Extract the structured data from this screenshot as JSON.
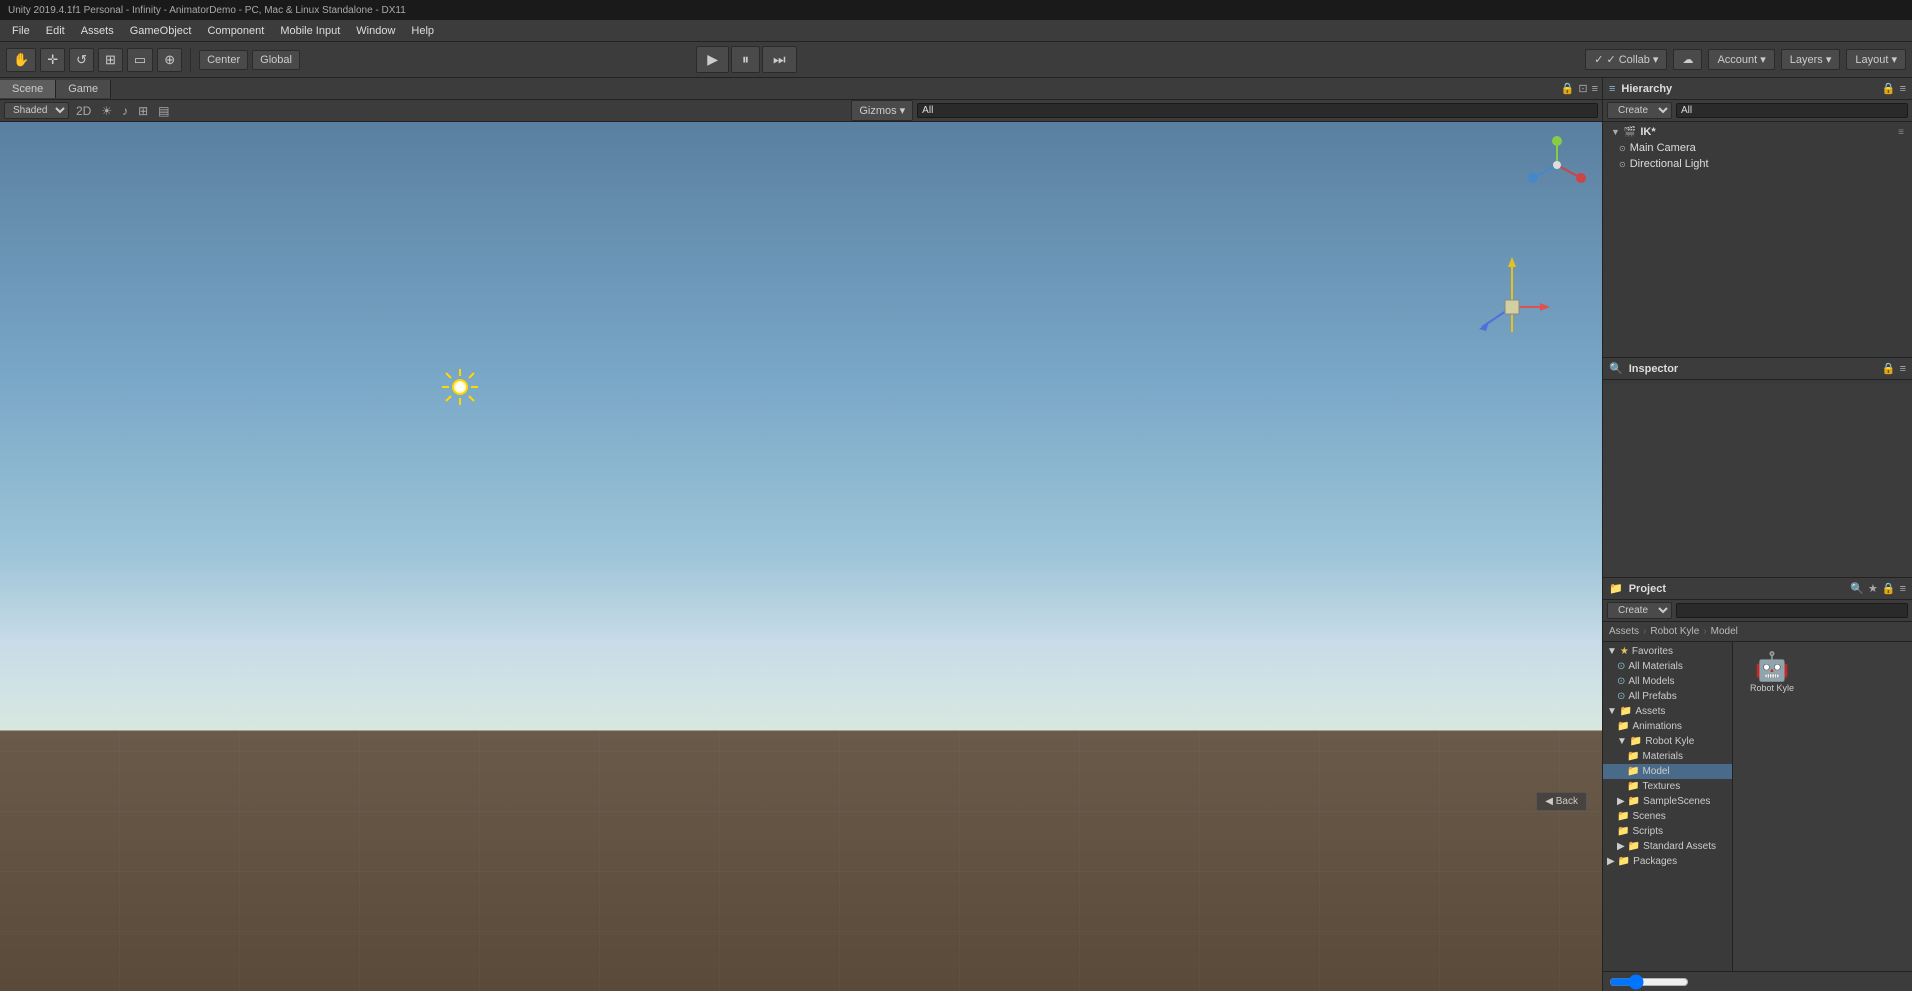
{
  "titlebar": {
    "text": "Unity 2019.4.1f1 Personal - Infinity - AnimatorDemo - PC, Mac & Linux Standalone - DX11"
  },
  "menubar": {
    "items": [
      "File",
      "Edit",
      "Assets",
      "GameObject",
      "Component",
      "Mobile Input",
      "Window",
      "Help"
    ]
  },
  "toolbar": {
    "hand_label": "✋",
    "move_label": "✛",
    "rotate_label": "↺",
    "scale_label": "⊞",
    "rect_label": "⬜",
    "transform_label": "⊕",
    "center_label": "Center",
    "global_label": "Global",
    "play_label": "▶",
    "pause_label": "⏸",
    "step_label": "⏭",
    "collab_label": "✓ Collab",
    "cloud_label": "☁",
    "account_label": "Account",
    "layers_label": "Layers",
    "layout_label": "Layout"
  },
  "scene_view": {
    "tab_scene": "Scene",
    "tab_game": "Game",
    "shading_mode": "Shaded",
    "dim_mode": "2D",
    "gizmos_label": "Gizmos",
    "search_placeholder": "All",
    "back_label": "◀ Back"
  },
  "hierarchy": {
    "title": "Hierarchy",
    "create_label": "Create",
    "search_placeholder": "All",
    "root": "IK*",
    "items": [
      {
        "label": "Main Camera",
        "indent": 1
      },
      {
        "label": "Directional Light",
        "indent": 1
      }
    ]
  },
  "inspector": {
    "title": "Inspector"
  },
  "project": {
    "title": "Project",
    "create_label": "Create",
    "search_placeholder": "",
    "breadcrumb": [
      "Assets",
      "Robot Kyle",
      "Model"
    ],
    "favorites": {
      "label": "Favorites",
      "items": [
        "All Materials",
        "All Models",
        "All Prefabs"
      ]
    },
    "assets": {
      "label": "Assets",
      "items": [
        {
          "label": "Animations",
          "indent": 1,
          "hasArrow": false
        },
        {
          "label": "Robot Kyle",
          "indent": 1,
          "hasArrow": true,
          "expanded": true
        },
        {
          "label": "Materials",
          "indent": 2,
          "hasArrow": false
        },
        {
          "label": "Model",
          "indent": 2,
          "hasArrow": false,
          "selected": true
        },
        {
          "label": "Textures",
          "indent": 2,
          "hasArrow": false
        },
        {
          "label": "SampleScenes",
          "indent": 1,
          "hasArrow": true
        },
        {
          "label": "Scenes",
          "indent": 1,
          "hasArrow": false
        },
        {
          "label": "Scripts",
          "indent": 1,
          "hasArrow": false
        },
        {
          "label": "Standard Assets",
          "indent": 1,
          "hasArrow": true
        }
      ]
    },
    "packages": {
      "label": "Packages",
      "hasArrow": true
    },
    "file_items": [
      {
        "name": "Robot Kyle",
        "type": "model"
      }
    ]
  }
}
